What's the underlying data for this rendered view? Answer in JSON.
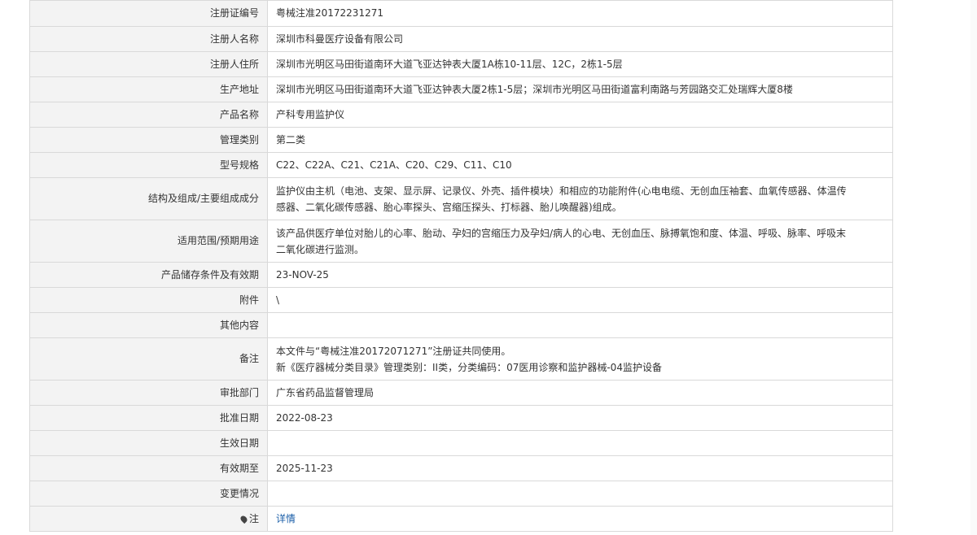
{
  "rows": [
    {
      "label": "注册证编号",
      "value": "粤械注准20172231271"
    },
    {
      "label": "注册人名称",
      "value": "深圳市科曼医疗设备有限公司"
    },
    {
      "label": "注册人住所",
      "value": "深圳市光明区马田街道南环大道飞亚达钟表大厦1A栋10-11层、12C，2栋1-5层"
    },
    {
      "label": "生产地址",
      "value": "深圳市光明区马田街道南环大道飞亚达钟表大厦2栋1-5层；深圳市光明区马田街道富利南路与芳园路交汇处瑞辉大厦8楼"
    },
    {
      "label": "产品名称",
      "value": "产科专用监护仪"
    },
    {
      "label": "管理类别",
      "value": "第二类"
    },
    {
      "label": "型号规格",
      "value": "C22、C22A、C21、C21A、C20、C29、C11、C10"
    },
    {
      "label": "结构及组成/主要组成成分",
      "value_lines": [
        "监护仪由主机（电池、支架、显示屏、记录仪、外壳、插件模块）和相应的功能附件(心电电缆、无创血压袖套、血氧传感器、体温传",
        "感器、二氧化碳传感器、胎心率探头、宫缩压探头、打标器、胎儿唤醒器)组成。"
      ]
    },
    {
      "label": "适用范围/预期用途",
      "value_lines": [
        "该产品供医疗单位对胎儿的心率、胎动、孕妇的宫缩压力及孕妇/病人的心电、无创血压、脉搏氧饱和度、体温、呼吸、脉率、呼吸末",
        "二氧化碳进行监测。"
      ]
    },
    {
      "label": "产品储存条件及有效期",
      "value": "23-NOV-25"
    },
    {
      "label": "附件",
      "value": "\\"
    },
    {
      "label": "其他内容",
      "value": ""
    },
    {
      "label": "备注",
      "value_lines": [
        "本文件与“粤械注准20172071271”注册证共同使用。",
        "新《医疗器械分类目录》管理类别：II类，分类编码：07医用诊察和监护器械-04监护设备"
      ]
    },
    {
      "label": "审批部门",
      "value": "广东省药品监督管理局"
    },
    {
      "label": "批准日期",
      "value": "2022-08-23"
    },
    {
      "label": "生效日期",
      "value": ""
    },
    {
      "label": "有效期至",
      "value": "2025-11-23"
    },
    {
      "label": "变更情况",
      "value": ""
    },
    {
      "label": "注",
      "value": "详情",
      "icon": "note-pin-icon",
      "link": true
    }
  ]
}
